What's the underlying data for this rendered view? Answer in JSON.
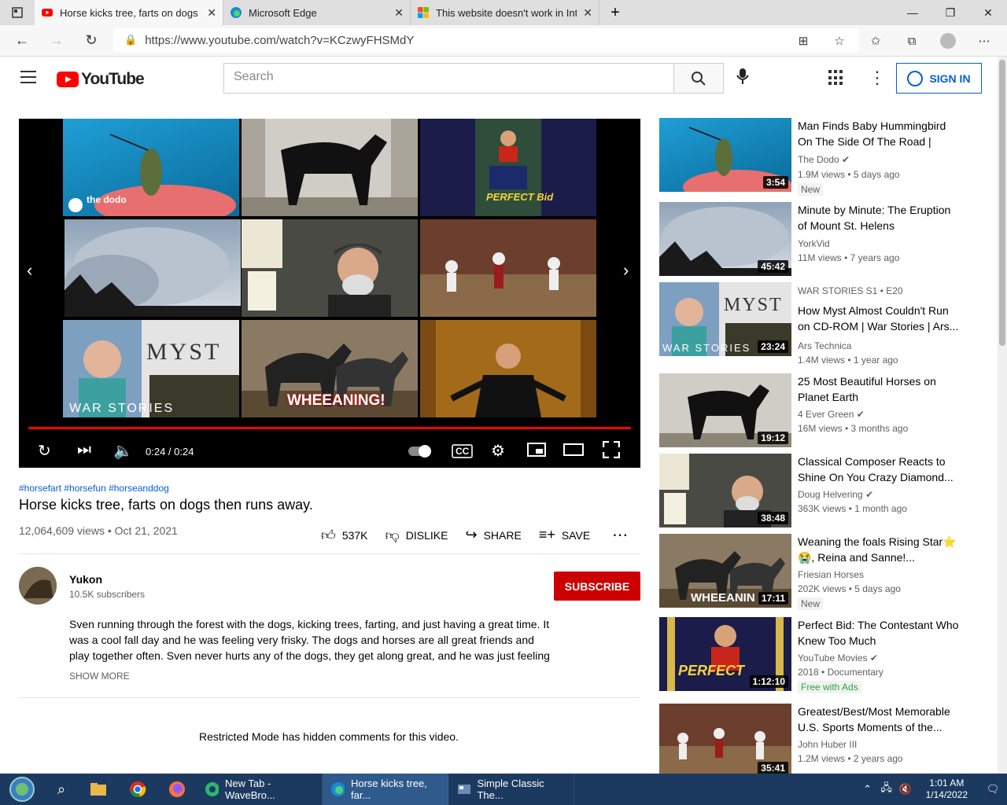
{
  "browser": {
    "tabs": [
      {
        "title": "Horse kicks tree, farts on dogs th",
        "active": true
      },
      {
        "title": "Microsoft Edge",
        "active": false
      },
      {
        "title": "This website doesn't work in Inte",
        "active": false
      }
    ],
    "url": "https://www.youtube.com/watch?v=KCzwyFHSMdY"
  },
  "youtube": {
    "logo": "YouTube",
    "search_placeholder": "Search",
    "sign_in": "SIGN IN"
  },
  "player": {
    "time": "0:24 / 0:24",
    "progress": 1.0,
    "endscreen_labels": [
      "the dodo",
      "PERFECT Bid",
      "MYST",
      "WAR STORIES",
      "WHEEANING!"
    ]
  },
  "video": {
    "hashtags": "#horsefart #horsefun #horseanddog",
    "title": "Horse kicks tree, farts on dogs then runs away.",
    "meta": "12,064,609 views • Oct 21, 2021",
    "likes": "537K",
    "dislike": "DISLIKE",
    "share": "SHARE",
    "save": "SAVE"
  },
  "channel": {
    "name": "Yukon",
    "subscribers": "10.5K subscribers",
    "subscribe": "SUBSCRIBE",
    "description": "Sven running through the forest with the dogs, kicking trees, farting, and just having a great time. It was a cool fall day and he was feeling very frisky. The dogs and horses are all great friends and play together often. Sven never hurts any of the dogs, they get along great, and he was just feeling",
    "show_more": "SHOW MORE"
  },
  "comments_notice": "Restricted Mode has hidden comments for this video.",
  "recommendations": [
    {
      "title": "Man Finds Baby Hummingbird On The Side Of The Road | The...",
      "channel": "The Dodo",
      "verified": true,
      "meta": "1.9M views • 5 days ago",
      "badge": "New",
      "duration": "3:54",
      "theme": "bird"
    },
    {
      "title": "Minute by Minute: The Eruption of Mount St. Helens",
      "channel": "YorkVid",
      "verified": false,
      "meta": "11M views • 7 years ago",
      "badge": "",
      "duration": "45:42",
      "theme": "smoke"
    },
    {
      "kicker": "WAR STORIES  S1 • E20",
      "title": "How Myst Almost Couldn't Run on CD-ROM | War Stories | Ars...",
      "channel": "Ars Technica",
      "verified": false,
      "meta": "1.4M views • 1 year ago",
      "badge": "",
      "duration": "23:24",
      "theme": "myst"
    },
    {
      "title": "25 Most Beautiful Horses on Planet Earth",
      "channel": "4 Ever Green",
      "verified": true,
      "meta": "16M views • 3 months ago",
      "badge": "",
      "duration": "19:12",
      "theme": "horse"
    },
    {
      "title": "Classical Composer Reacts to Shine On You Crazy Diamond...",
      "channel": "Doug Helvering",
      "verified": true,
      "meta": "363K views • 1 month ago",
      "badge": "",
      "duration": "38:48",
      "theme": "composer"
    },
    {
      "title": "Weaning the foals Rising Star⭐😭, Reina and Sanne!...",
      "channel": "Friesian Horses",
      "verified": false,
      "meta": "202K views • 5 days ago",
      "badge": "New",
      "duration": "17:11",
      "theme": "foals"
    },
    {
      "title": "Perfect Bid: The Contestant Who Knew Too Much",
      "channel": "YouTube Movies",
      "verified": true,
      "meta": "2018 • Documentary",
      "badge": "Free with Ads",
      "duration": "1:12:10",
      "theme": "bid"
    },
    {
      "title": "Greatest/Best/Most Memorable U.S. Sports Moments of the...",
      "channel": "John Huber III",
      "verified": false,
      "meta": "1.2M views • 2 years ago",
      "badge": "",
      "duration": "35:41",
      "theme": "sports"
    }
  ],
  "taskbar": {
    "apps": [
      {
        "title": "New Tab - WaveBro...",
        "active": false
      },
      {
        "title": "Horse kicks tree, far...",
        "active": true
      },
      {
        "title": "Simple Classic The...",
        "active": false
      }
    ],
    "time": "1:01 AM",
    "date": "1/14/2022"
  },
  "colors": {
    "youtube_red": "#ff0000",
    "subscribe_red": "#cc0000",
    "link_blue": "#065fd4",
    "taskbar": "#1c3a5f"
  }
}
